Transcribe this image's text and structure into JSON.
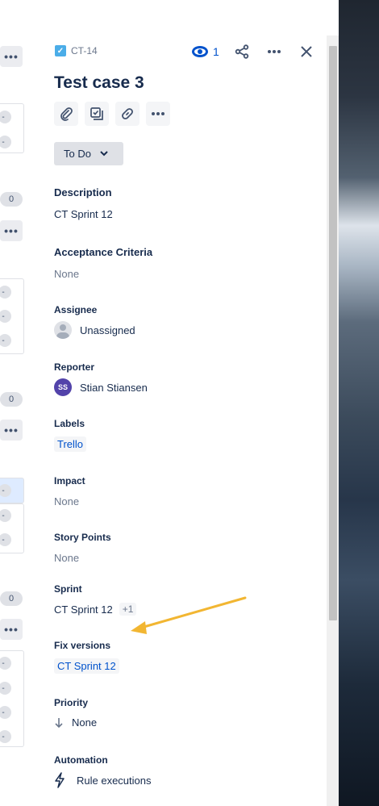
{
  "board": {
    "counts": [
      "0",
      "0",
      "0"
    ],
    "pill_text": "-"
  },
  "issue": {
    "key": "CT-14",
    "title": "Test case 3",
    "watch_count": "1",
    "status": "To Do"
  },
  "fields": {
    "description": {
      "label": "Description",
      "value": "CT Sprint 12"
    },
    "acceptance": {
      "label": "Acceptance Criteria",
      "value": "None"
    },
    "assignee": {
      "label": "Assignee",
      "value": "Unassigned"
    },
    "reporter": {
      "label": "Reporter",
      "value": "Stian Stiansen",
      "initials": "SS"
    },
    "labels": {
      "label": "Labels",
      "value": "Trello"
    },
    "impact": {
      "label": "Impact",
      "value": "None"
    },
    "story_points": {
      "label": "Story Points",
      "value": "None"
    },
    "sprint": {
      "label": "Sprint",
      "value": "CT Sprint 12",
      "extra": "+1"
    },
    "fix_versions": {
      "label": "Fix versions",
      "value": "CT Sprint 12"
    },
    "priority": {
      "label": "Priority",
      "value": "None"
    },
    "automation": {
      "label": "Automation",
      "value": "Rule executions"
    }
  },
  "icons": {
    "issue_type": "checkbox-icon",
    "watch": "eye-icon",
    "share": "share-icon",
    "more": "more-icon",
    "close": "close-icon",
    "attach": "paperclip-icon",
    "subtask": "subtask-icon",
    "link": "link-icon",
    "priority": "arrow-down-icon",
    "automation": "lightning-icon"
  },
  "colors": {
    "accent": "#0052cc",
    "avatar": "#5243aa",
    "annotation_arrow": "#f2b632",
    "issue_type": "#4bade8"
  }
}
